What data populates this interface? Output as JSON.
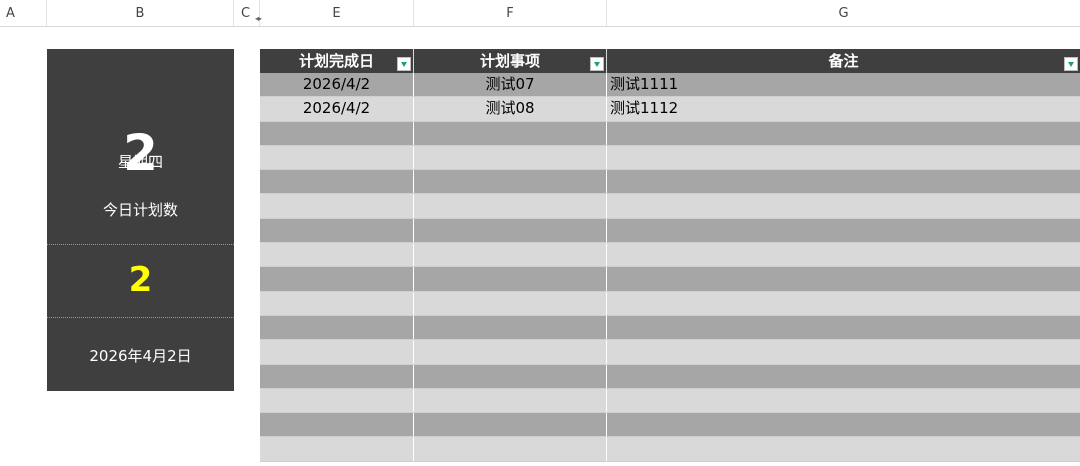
{
  "columns": {
    "a": "A",
    "b": "B",
    "c": "C",
    "e": "E",
    "f": "F",
    "g": "G"
  },
  "panel": {
    "day": "2",
    "weekday": "星期四",
    "plan_label": "今日计划数",
    "plan_count": "2",
    "full_date": "2026年4月2日",
    "count_color": "#ffff00"
  },
  "table": {
    "headers": [
      "计划完成日",
      "计划事项",
      "备注"
    ],
    "rows": [
      [
        "2026/4/2",
        "测试07",
        "测试1111"
      ],
      [
        "2026/4/2",
        "测试08",
        "测试1112"
      ],
      [
        "",
        "",
        ""
      ],
      [
        "",
        "",
        ""
      ],
      [
        "",
        "",
        ""
      ],
      [
        "",
        "",
        ""
      ],
      [
        "",
        "",
        ""
      ],
      [
        "",
        "",
        ""
      ],
      [
        "",
        "",
        ""
      ],
      [
        "",
        "",
        ""
      ],
      [
        "",
        "",
        ""
      ],
      [
        "",
        "",
        ""
      ],
      [
        "",
        "",
        ""
      ],
      [
        "",
        "",
        ""
      ],
      [
        "",
        "",
        ""
      ],
      [
        "",
        "",
        ""
      ]
    ],
    "header_color": "#3f3f3f",
    "band_dark": "#a6a6a6",
    "band_light": "#d9d9d9",
    "filter_icon_color": "#21a366"
  }
}
